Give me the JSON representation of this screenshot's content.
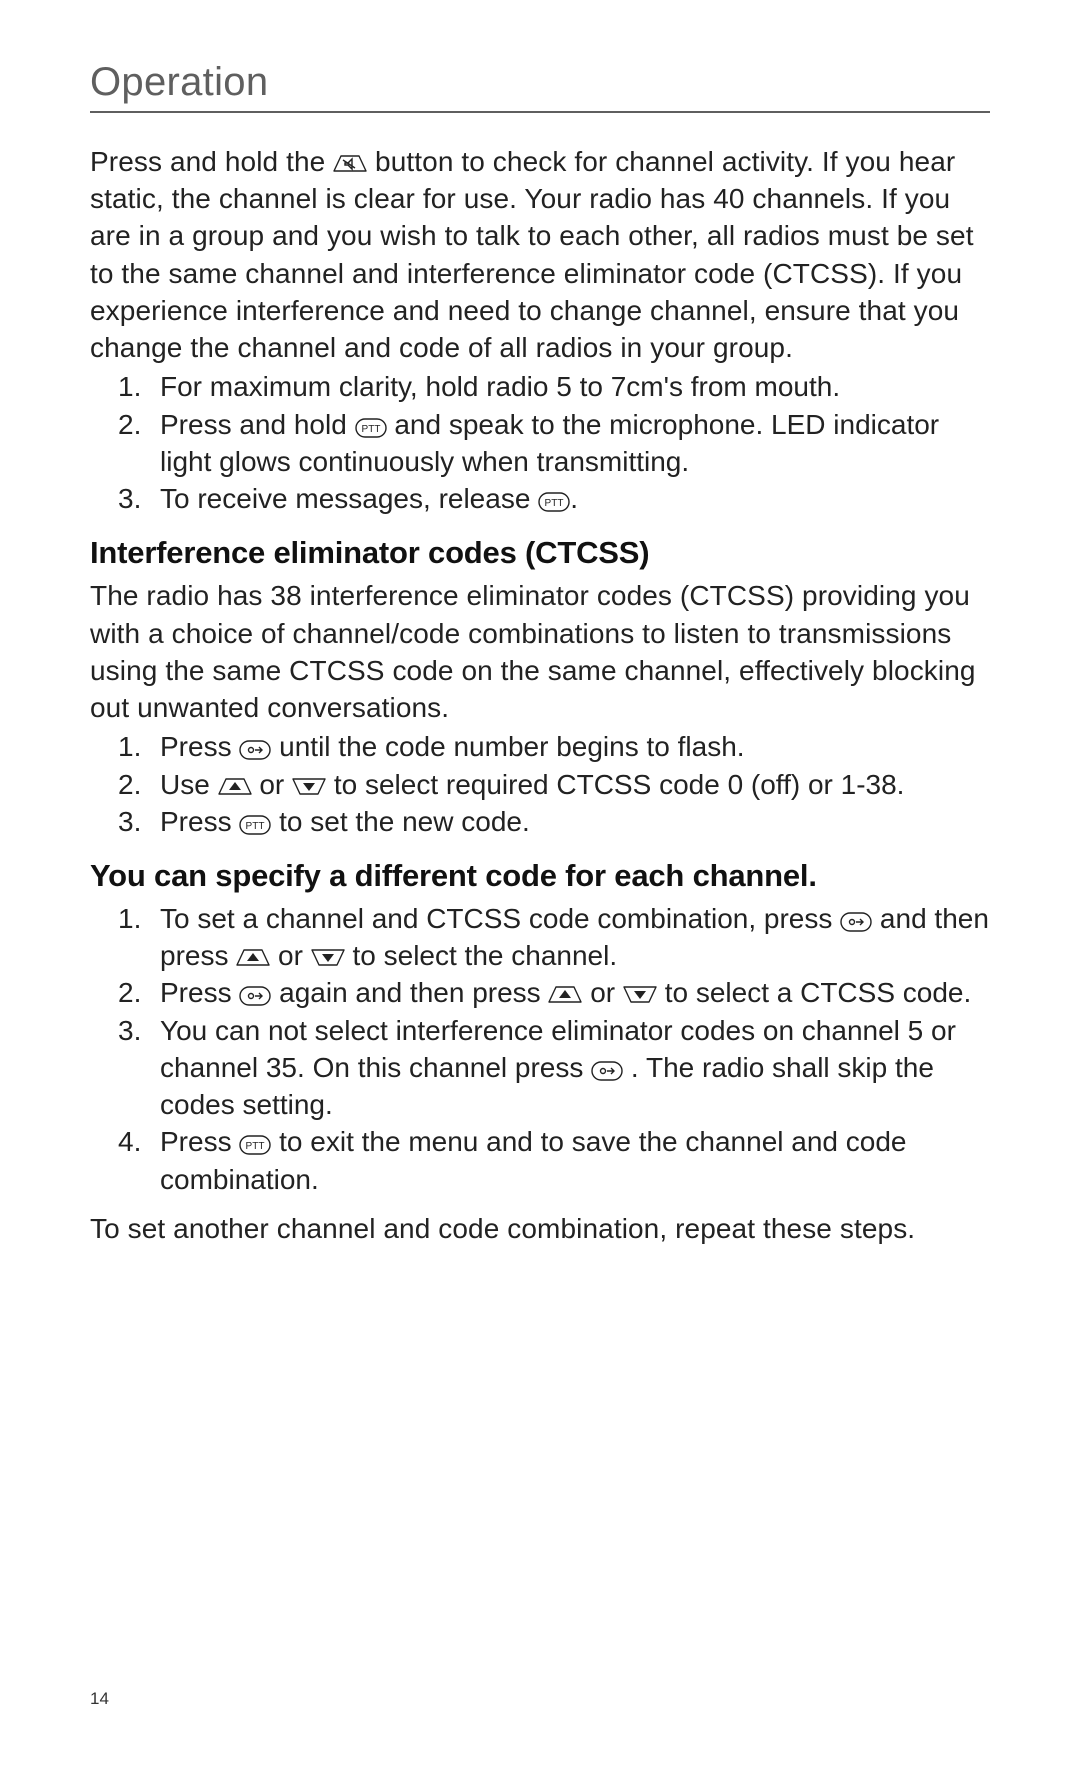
{
  "section_title": "Operation",
  "page_number": "14",
  "intro": {
    "p1a": "Press and hold the ",
    "p1b": " button to check for channel activity. If you hear static, the channel is clear for use. Your radio has 40 channels. If you are in a group and you wish to talk to each other, all radios must be set to the same channel and interference eliminator code (CTCSS). If you experience interference and need to change channel, ensure that you change the channel and code of all radios in your group."
  },
  "list1": {
    "n1": "1.",
    "n2": "2.",
    "n3": "3.",
    "i1": "For maximum clarity, hold radio 5 to 7cm's from mouth.",
    "i2a": "Press and hold ",
    "i2b": " and speak to the microphone. LED indicator light glows continuously when transmitting.",
    "i3a": "To receive messages, release ",
    "i3b": "."
  },
  "heading2": "Interference eliminator codes (CTCSS)",
  "ctcss_intro": "The radio has 38 interference eliminator codes (CTCSS) providing you with a choice of channel/code combinations to listen to transmissions using the same CTCSS code on the same channel, effectively blocking out unwanted conversations.",
  "list2": {
    "n1": "1.",
    "n2": "2.",
    "n3": "3.",
    "i1a": "Press ",
    "i1b": " until the code number begins to flash.",
    "i2a": "Use ",
    "i2b": " or ",
    "i2c": " to select required CTCSS code 0 (off) or 1-38.",
    "i3a": "Press ",
    "i3b": " to set the new code."
  },
  "heading3": "You can specify a different code for each channel.",
  "list3": {
    "n1": "1.",
    "n2": "2.",
    "n3": "3.",
    "n4": "4.",
    "i1a": "To set a channel and CTCSS code combination, press ",
    "i1b": " and then press ",
    "i1c": " or ",
    "i1d": " to select the channel.",
    "i2a": "Press ",
    "i2b": " again and then press ",
    "i2c": " or ",
    "i2d": " to select a CTCSS code.",
    "i3a": "You can not select interference eliminator codes on channel 5 or channel 35. On this channel press ",
    "i3b": " . The radio shall skip the codes setting.",
    "i4a": "Press ",
    "i4b": " to exit the menu and to save the channel and code combination."
  },
  "outro": "To set another channel and code combination, repeat these steps."
}
